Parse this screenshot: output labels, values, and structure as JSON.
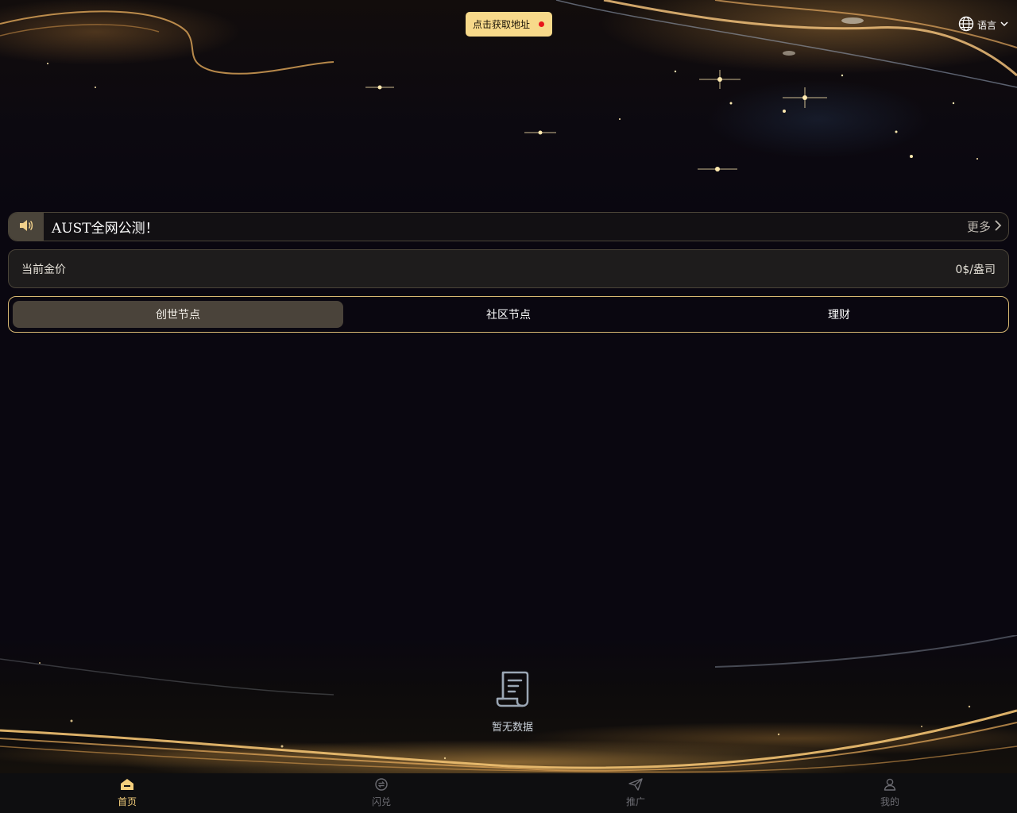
{
  "header": {
    "address_button": "点击获取地址",
    "language_label": "语言"
  },
  "notice": {
    "text": "AUST全网公测！",
    "more_label": "更多"
  },
  "gold_price": {
    "label": "当前金价",
    "value": "0$/盎司"
  },
  "tabs": [
    {
      "label": "创世节点",
      "active": true
    },
    {
      "label": "社区节点",
      "active": false
    },
    {
      "label": "理财",
      "active": false
    }
  ],
  "empty_state": {
    "text": "暂无数据"
  },
  "bottom_nav": [
    {
      "label": "首页",
      "icon": "home-icon",
      "active": true
    },
    {
      "label": "闪兑",
      "icon": "swap-icon",
      "active": false
    },
    {
      "label": "推广",
      "icon": "send-icon",
      "active": false
    },
    {
      "label": "我的",
      "icon": "user-icon",
      "active": false
    }
  ],
  "colors": {
    "accent_gold": "#f7d98a",
    "active_nav": "#f4cf7c",
    "tab_border": "#d8b873",
    "status_dot": "#e8141a",
    "background": "#0a0710"
  }
}
